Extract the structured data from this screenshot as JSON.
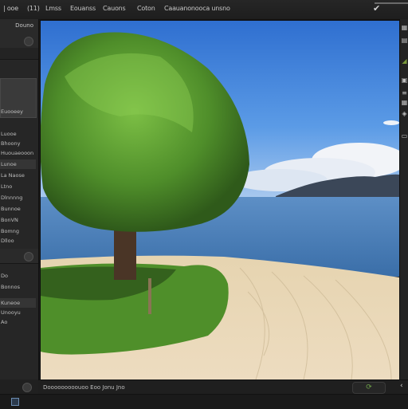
{
  "menubar": {
    "items": [
      {
        "label": "| ooe"
      },
      {
        "label": "(11)"
      },
      {
        "label": "Lmss"
      },
      {
        "label": "Eouanss"
      },
      {
        "label": "Cauons"
      },
      {
        "label": "Coton"
      },
      {
        "label": "Caauanonooca unsno"
      }
    ]
  },
  "toolbar_right": {
    "icons": [
      "checkmark-icon"
    ]
  },
  "left_panel": {
    "header_label": "Douno",
    "items": [
      {
        "label": "Euooeey"
      },
      {
        "label": "Luooe"
      },
      {
        "label": "Bhoony"
      },
      {
        "label": "Huouaeooon"
      },
      {
        "label": "Lunoe",
        "selected": true
      },
      {
        "label": "La Naose"
      },
      {
        "label": "Ltno"
      },
      {
        "label": "Dlnnnng"
      },
      {
        "label": "Bunnoe"
      },
      {
        "label": "BonVN"
      },
      {
        "label": "Bomng"
      },
      {
        "label": "Dlloo"
      },
      {
        "label": "Do"
      },
      {
        "label": "Bonnos"
      },
      {
        "label": "Kuneoe"
      },
      {
        "label": "Unooyu"
      },
      {
        "label": "Ao"
      }
    ]
  },
  "canvas": {
    "description": "Landscape photo: tree on sandy beach by blue lake with mountain and clouds",
    "colors": {
      "sky": "#3f7fd6",
      "water": "#4b7fb6",
      "sand": "#e8d8b8",
      "grass": "#5e9a2e",
      "mountain": "#3d4a5a"
    }
  },
  "right_toolbar": {
    "icons": [
      "grid-icon",
      "layers-icon",
      "triangle-icon",
      "crop-icon",
      "list-icon",
      "grid-icon",
      "adjust-icon",
      "frame-icon"
    ]
  },
  "statusbar": {
    "text": "Dooooooooouoo Eoo Jonu Jno",
    "refresh_icon": "refresh-icon"
  }
}
